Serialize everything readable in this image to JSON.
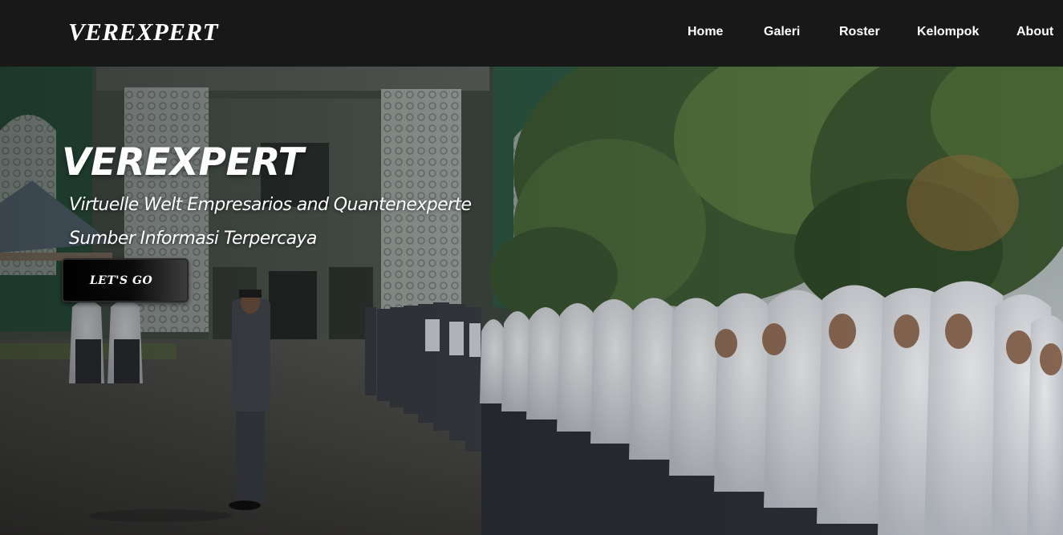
{
  "navbar": {
    "brand": "VEREXPERT",
    "links": [
      "Home",
      "Galeri",
      "Roster",
      "Kelompok",
      "About"
    ]
  },
  "hero": {
    "title": "VEREXPERT",
    "subtitle_1": "Virtuelle Welt Empresarios and Quantenexperte",
    "subtitle_2": "Sumber Informasi Terpercaya",
    "cta_label": "LET'S GO",
    "background_image": "school-assembly-photo"
  },
  "colors": {
    "navbar_bg": "#181818",
    "text": "#ffffff",
    "button_bg": "#000000"
  }
}
